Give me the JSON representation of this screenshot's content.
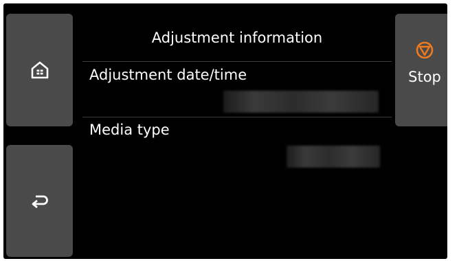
{
  "screen": {
    "title": "Adjustment information"
  },
  "buttons": {
    "home": {
      "icon": "home-icon"
    },
    "back": {
      "icon": "back-arrow-icon"
    },
    "stop": {
      "icon": "stop-icon",
      "label": "Stop",
      "icon_color": "#f07a1f"
    }
  },
  "fields": {
    "adjustment_datetime": {
      "label": "Adjustment date/time"
    },
    "media_type": {
      "label": "Media type"
    }
  }
}
